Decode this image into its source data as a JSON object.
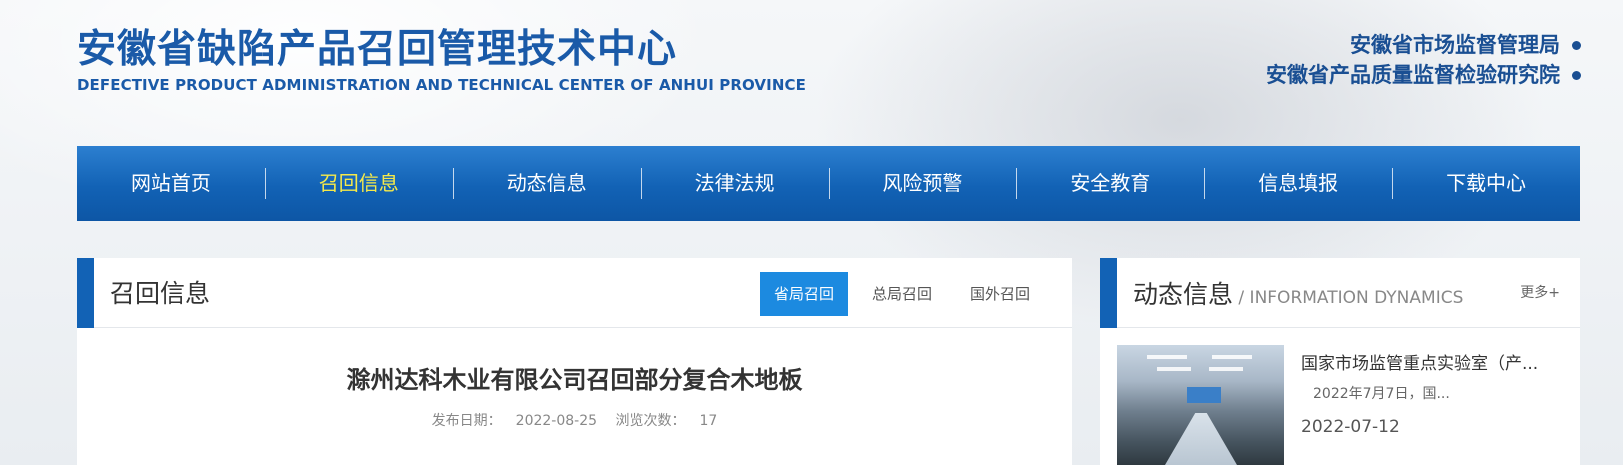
{
  "header": {
    "logo_cn": "安徽省缺陷产品召回管理技术中心",
    "logo_en": "DEFECTIVE PRODUCT ADMINISTRATION AND TECHNICAL CENTER OF ANHUI PROVINCE",
    "orgs": [
      "安徽省市场监督管理局",
      "安徽省产品质量监督检验研究院"
    ]
  },
  "nav": {
    "items": [
      "网站首页",
      "召回信息",
      "动态信息",
      "法律法规",
      "风险预警",
      "安全教育",
      "信息填报",
      "下载中心"
    ],
    "active_index": 1
  },
  "main": {
    "title": "召回信息",
    "tabs": [
      "省局召回",
      "总局召回",
      "国外召回"
    ],
    "active_tab": 0,
    "article": {
      "title": "滁州达科木业有限公司召回部分复合木地板",
      "date_label": "发布日期：",
      "date": "2022-08-25",
      "views_label": "浏览次数：",
      "views": "17"
    }
  },
  "side": {
    "title_cn": "动态信息",
    "title_en": " / INFORMATION DYNAMICS",
    "more": "更多+",
    "news": [
      {
        "title": "国家市场监管重点实验室（产...",
        "summary": "2022年7月7日，国...",
        "date": "2022-07-12"
      }
    ]
  },
  "colors": {
    "brand_blue": "#1a5aa8",
    "nav_blue": "#1262b5",
    "nav_active": "#f5e94a",
    "tab_active": "#1c8ae0"
  }
}
